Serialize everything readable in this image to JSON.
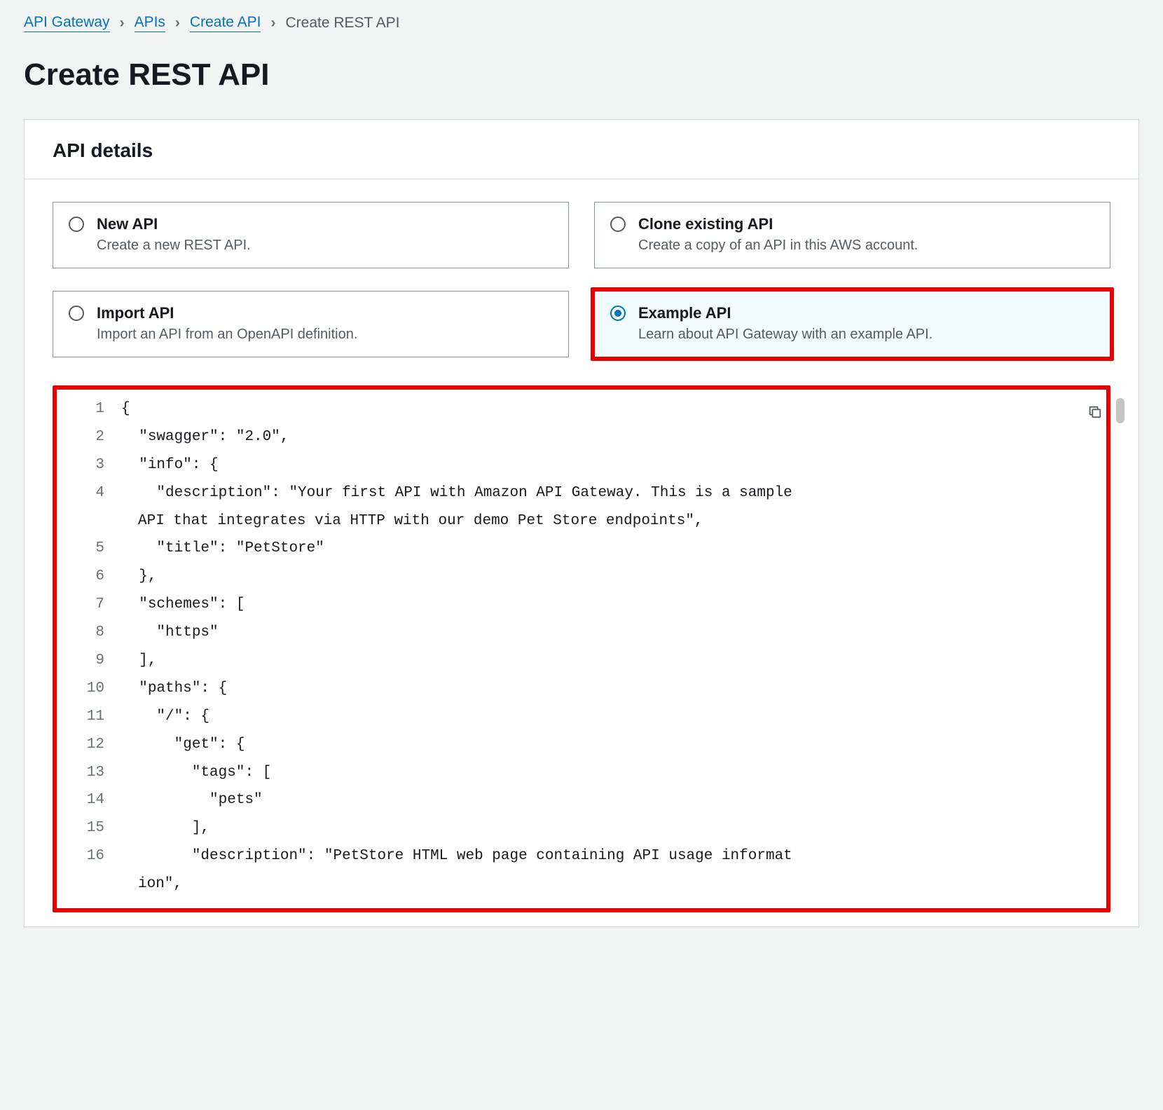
{
  "breadcrumb": {
    "items": [
      {
        "label": "API Gateway",
        "link": true
      },
      {
        "label": "APIs",
        "link": true
      },
      {
        "label": "Create API",
        "link": true
      },
      {
        "label": "Create REST API",
        "link": false
      }
    ]
  },
  "page_title": "Create REST API",
  "panel": {
    "title": "API details"
  },
  "options": [
    {
      "title": "New API",
      "desc": "Create a new REST API.",
      "selected": false
    },
    {
      "title": "Clone existing API",
      "desc": "Create a copy of an API in this AWS account.",
      "selected": false
    },
    {
      "title": "Import API",
      "desc": "Import an API from an OpenAPI definition.",
      "selected": false
    },
    {
      "title": "Example API",
      "desc": "Learn about API Gateway with an example API.",
      "selected": true
    }
  ],
  "code_lines": [
    {
      "n": "1",
      "t": "{"
    },
    {
      "n": "2",
      "t": "  \"swagger\": \"2.0\","
    },
    {
      "n": "3",
      "t": "  \"info\": {"
    },
    {
      "n": "4",
      "t": "    \"description\": \"Your first API with Amazon API Gateway. This is a sample",
      "wrap": "API that integrates via HTTP with our demo Pet Store endpoints\","
    },
    {
      "n": "5",
      "t": "    \"title\": \"PetStore\""
    },
    {
      "n": "6",
      "t": "  },"
    },
    {
      "n": "7",
      "t": "  \"schemes\": ["
    },
    {
      "n": "8",
      "t": "    \"https\""
    },
    {
      "n": "9",
      "t": "  ],"
    },
    {
      "n": "10",
      "t": "  \"paths\": {"
    },
    {
      "n": "11",
      "t": "    \"/\": {"
    },
    {
      "n": "12",
      "t": "      \"get\": {"
    },
    {
      "n": "13",
      "t": "        \"tags\": ["
    },
    {
      "n": "14",
      "t": "          \"pets\""
    },
    {
      "n": "15",
      "t": "        ],"
    },
    {
      "n": "16",
      "t": "        \"description\": \"PetStore HTML web page containing API usage informat",
      "wrap": "ion\","
    }
  ]
}
